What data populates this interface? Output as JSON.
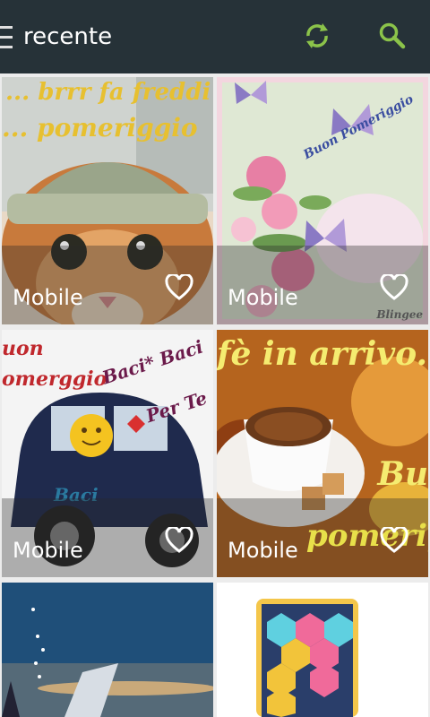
{
  "header": {
    "title": "recente",
    "accent": "#8bc34a",
    "background": "#263238",
    "icons": [
      "menu-icon",
      "refresh-icon",
      "search-icon"
    ]
  },
  "tiles": [
    {
      "label": "Mobile",
      "caption_top": "... brrr fa freddi",
      "caption_mid": "... pomeriggio"
    },
    {
      "label": "Mobile",
      "caption_mid": "Buon Pomeriggio",
      "signature": "Blingee"
    },
    {
      "label": "Mobile",
      "caption_left1": "uon",
      "caption_left2": "omerggio",
      "caption_right1": "Baci* Baci",
      "caption_right2": "Per Te",
      "car_text": "Baci"
    },
    {
      "label": "Mobile",
      "caption_top": "fè in arrivo...",
      "caption_right": "Bu",
      "caption_bottom": "pomeriggi"
    },
    {
      "label": ""
    },
    {
      "label": ""
    }
  ]
}
